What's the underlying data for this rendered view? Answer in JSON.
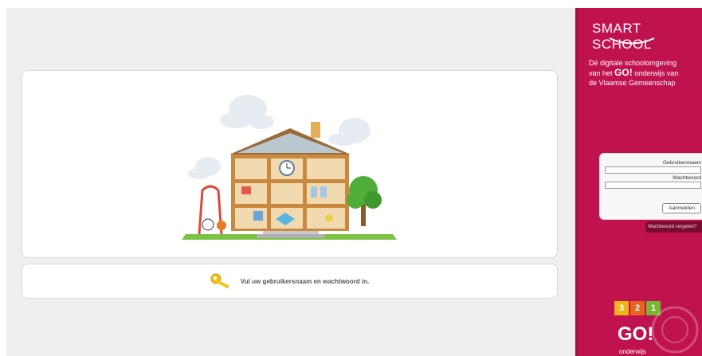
{
  "sidebar": {
    "logo_text": "SMART SCHOOL",
    "tagline_line1": "Dé digitale schoolomgeving",
    "tagline_pre": "van het ",
    "tagline_go": "GO!",
    "tagline_post": " onderwijs van",
    "tagline_line3": "de Vlaamse Gemeenschap",
    "username_label": "Gebruikersnaam",
    "username_value": "",
    "password_label": "Wachtwoord",
    "password_value": "",
    "login_button": "Aanmelden",
    "forgot_link": "Wachtwoord vergeten?",
    "badges": [
      "3",
      "2",
      "1"
    ],
    "badge_colors": [
      "#f2b21a",
      "#e8651f",
      "#7ab534"
    ],
    "go_logo": "GO!",
    "go_sub": "onderwijs"
  },
  "main": {
    "message": "Vul uw gebruikersnaam en wachtwoord in."
  },
  "colors": {
    "brand": "#c0124e",
    "panel_bg": "#efefef"
  }
}
